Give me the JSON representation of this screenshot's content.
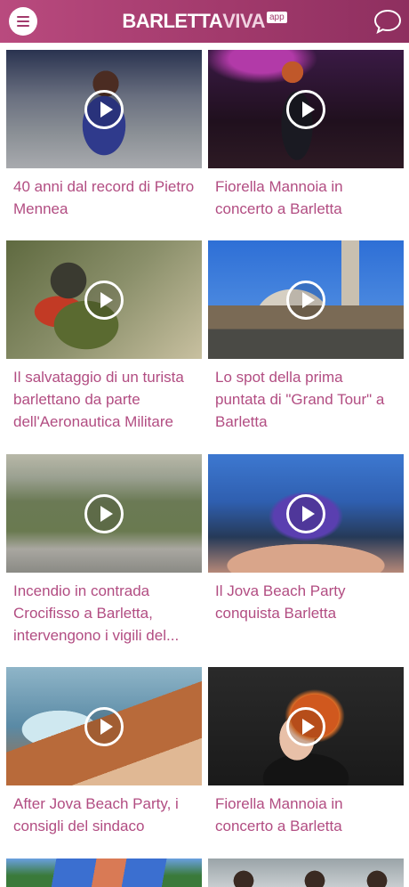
{
  "header": {
    "logo_part1": "BARLETTA",
    "logo_part2": "VIVA",
    "logo_badge": "app",
    "menu_icon": "hamburger-menu-icon",
    "chat_icon": "chat-bubble-icon",
    "accent_color": "#a23a6c",
    "title_color": "#b24d82"
  },
  "videos": [
    {
      "title": "40 anni dal record di Pietro Mennea"
    },
    {
      "title": "Fiorella Mannoia in concerto a Barletta"
    },
    {
      "title": "Il salvataggio di un turista barlettano da parte dell'Aeronautica Militare"
    },
    {
      "title": "Lo spot della prima puntata di \"Grand Tour\" a Barletta"
    },
    {
      "title": "Incendio in contrada Crocifisso a Barletta, intervengono i vigili del..."
    },
    {
      "title": "Il Jova Beach Party conquista Barletta"
    },
    {
      "title": "After Jova Beach Party, i consigli del sindaco"
    },
    {
      "title": "Fiorella Mannoia in concerto a Barletta"
    },
    {
      "title": ""
    },
    {
      "title": ""
    }
  ]
}
